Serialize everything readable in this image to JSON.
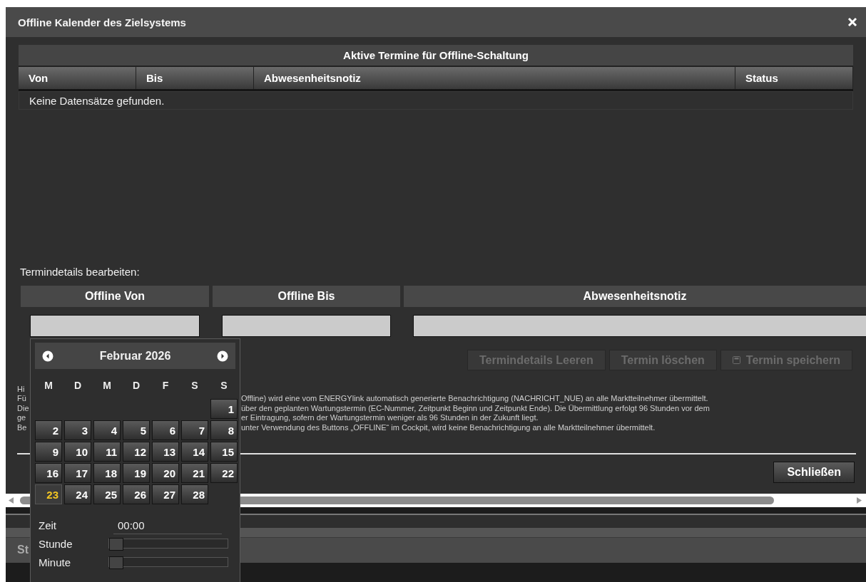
{
  "dialog": {
    "title": "Offline Kalender des Zielsystems"
  },
  "appointments_table": {
    "caption": "Aktive Termine für Offline-Schaltung",
    "columns": [
      "Von",
      "Bis",
      "Abwesenheitsnotiz",
      "Status"
    ],
    "empty_message": "Keine Datensätze gefunden."
  },
  "edit_section": {
    "label": "Termindetails bearbeiten:",
    "fields": [
      {
        "label": "Offline Von"
      },
      {
        "label": "Offline Bis"
      },
      {
        "label": "Abwesenheitsnotiz"
      }
    ],
    "buttons": [
      {
        "label": "Termindetails Leeren",
        "kind": "plain",
        "disabled": true
      },
      {
        "label": "Termin löschen",
        "kind": "plain",
        "disabled": true
      },
      {
        "label": "Termin speichern",
        "kind": "save",
        "disabled": true
      }
    ]
  },
  "hint_lines": [
    {
      "left": "Hi"
    },
    {
      "left": "Fü",
      "right": "Offline) wird eine vom ENERGYlink automatisch generierte Benachrichtigung (NACHRICHT_NUE) an alle Marktteilnehmer übermittelt."
    },
    {
      "left": "Die",
      "right": "über den geplanten Wartungstermin (EC-Nummer, Zeitpunkt Beginn und Zeitpunkt Ende). Die Übermittlung erfolgt 96 Stunden vor dem"
    },
    {
      "left": "ge",
      "right": "er Eintragung, sofern der Wartungstermin weniger als 96 Stunden in der Zukunft liegt."
    },
    {
      "left": "Be",
      "right": "unter Verwendung des Buttons „OFFLINE“ im Cockpit, wird keine Benachrichtigung an alle Marktteilnehmer übermittelt."
    }
  ],
  "close_button": "Schließen",
  "background_tab": "St",
  "datepicker": {
    "month": "Februar 2026",
    "weekdays": [
      "M",
      "D",
      "M",
      "D",
      "F",
      "S",
      "S"
    ],
    "weeks": [
      [
        {
          "day": "1",
          "selected": false
        }
      ],
      [
        {
          "day": "2",
          "selected": false
        },
        {
          "day": "3",
          "selected": false
        },
        {
          "day": "4",
          "selected": false
        },
        {
          "day": "5",
          "selected": false
        },
        {
          "day": "6",
          "selected": false
        },
        {
          "day": "7",
          "selected": false
        },
        {
          "day": "8",
          "selected": false
        }
      ],
      [
        {
          "day": "9",
          "selected": false
        },
        {
          "day": "10",
          "selected": false
        },
        {
          "day": "11",
          "selected": false
        },
        {
          "day": "12",
          "selected": false
        },
        {
          "day": "13",
          "selected": false
        },
        {
          "day": "14",
          "selected": false
        },
        {
          "day": "15",
          "selected": false
        }
      ],
      [
        {
          "day": "16",
          "selected": false
        },
        {
          "day": "17",
          "selected": false
        },
        {
          "day": "18",
          "selected": false
        },
        {
          "day": "19",
          "selected": false
        },
        {
          "day": "20",
          "selected": false
        },
        {
          "day": "21",
          "selected": false
        },
        {
          "day": "22",
          "selected": false
        }
      ],
      [
        {
          "day": "23",
          "selected": true
        },
        {
          "day": "24",
          "selected": false
        },
        {
          "day": "25",
          "selected": false
        },
        {
          "day": "26",
          "selected": false
        },
        {
          "day": "27",
          "selected": false
        },
        {
          "day": "28",
          "selected": false
        }
      ]
    ],
    "time": {
      "label": "Zeit",
      "value": "00:00"
    },
    "sliders": [
      {
        "label": "Stunde",
        "level": 0
      },
      {
        "label": "Minute",
        "level": 0
      }
    ]
  }
}
